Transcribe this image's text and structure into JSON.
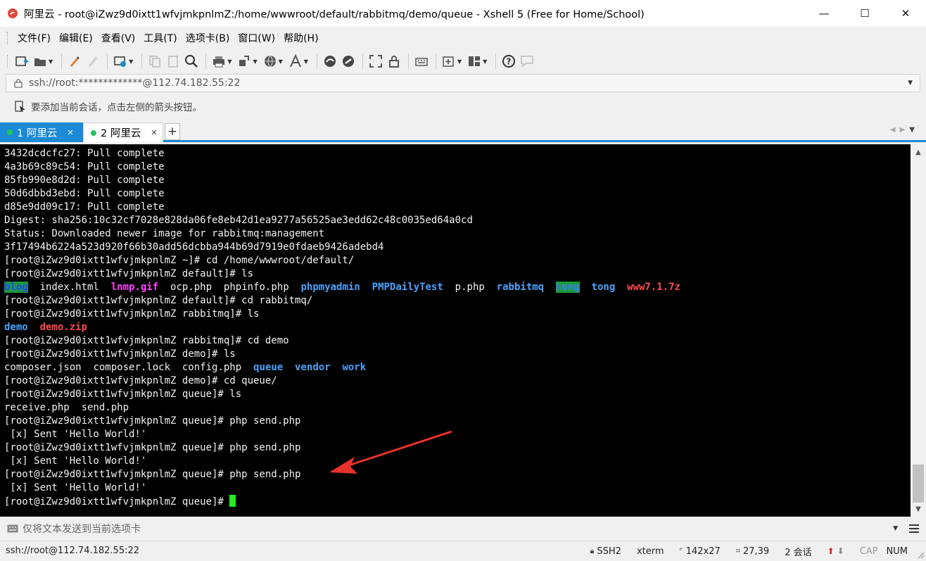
{
  "window": {
    "title": "阿里云 - root@iZwz9d0ixtt1wfvjmkpnlmZ:/home/wwwroot/default/rabbitmq/demo/queue - Xshell 5 (Free for Home/School)",
    "minimize": "—",
    "maximize": "☐",
    "close": "✕"
  },
  "menu": [
    "文件(F)",
    "编辑(E)",
    "查看(V)",
    "工具(T)",
    "选项卡(B)",
    "窗口(W)",
    "帮助(H)"
  ],
  "address": {
    "value": "ssh://root:*************@112.74.182.55:22"
  },
  "hint": "要添加当前会话，点击左侧的箭头按钮。",
  "tabs": [
    {
      "label": "1 阿里云",
      "status": "connected",
      "active": true
    },
    {
      "label": "2 阿里云",
      "status": "connected",
      "active": false
    }
  ],
  "terminal": {
    "lines": [
      "3432dcdcfc27: Pull complete",
      "4a3b69c89c54: Pull complete",
      "85fb990e8d2d: Pull complete",
      "50d6dbbd3ebd: Pull complete",
      "d85e9dd09c17: Pull complete",
      "Digest: sha256:10c32cf7028e828da06fe8eb42d1ea9277a56525ae3edd62c48c0035ed64a0cd",
      "Status: Downloaded newer image for rabbitmq:management",
      "3f17494b6224a523d920f66b30add56dcbba944b69d7919e0fdaeb9426adebd4",
      "[root@iZwz9d0ixtt1wfvjmkpnlmZ ~]# cd /home/wwwroot/default/",
      "[root@iZwz9d0ixtt1wfvjmkpnlmZ default]# ls"
    ],
    "ls_default": [
      {
        "name": "blog",
        "kind": "dir-highlight"
      },
      {
        "name": "index.html",
        "kind": "file"
      },
      {
        "name": "lnmp.gif",
        "kind": "image"
      },
      {
        "name": "ocp.php",
        "kind": "file"
      },
      {
        "name": "phpinfo.php",
        "kind": "file"
      },
      {
        "name": "phpmyadmin",
        "kind": "dir"
      },
      {
        "name": "PMPDailyTest",
        "kind": "dir"
      },
      {
        "name": "p.php",
        "kind": "file"
      },
      {
        "name": "rabbitmq",
        "kind": "dir"
      },
      {
        "name": "song",
        "kind": "dir-highlight"
      },
      {
        "name": "tong",
        "kind": "dir"
      },
      {
        "name": "www7.1.7z",
        "kind": "archive"
      }
    ],
    "lines2": [
      "[root@iZwz9d0ixtt1wfvjmkpnlmZ default]# cd rabbitmq/",
      "[root@iZwz9d0ixtt1wfvjmkpnlmZ rabbitmq]# ls"
    ],
    "ls_rabbitmq": [
      {
        "name": "demo",
        "kind": "dir"
      },
      {
        "name": "demo.zip",
        "kind": "archive"
      }
    ],
    "lines3": [
      "[root@iZwz9d0ixtt1wfvjmkpnlmZ rabbitmq]# cd demo",
      "[root@iZwz9d0ixtt1wfvjmkpnlmZ demo]# ls"
    ],
    "ls_demo": [
      {
        "name": "composer.json",
        "kind": "file"
      },
      {
        "name": "composer.lock",
        "kind": "file"
      },
      {
        "name": "config.php",
        "kind": "file"
      },
      {
        "name": "queue",
        "kind": "dir"
      },
      {
        "name": "vendor",
        "kind": "dir"
      },
      {
        "name": "work",
        "kind": "dir"
      }
    ],
    "lines4": [
      "[root@iZwz9d0ixtt1wfvjmkpnlmZ demo]# cd queue/",
      "[root@iZwz9d0ixtt1wfvjmkpnlmZ queue]# ls",
      "receive.php  send.php",
      "[root@iZwz9d0ixtt1wfvjmkpnlmZ queue]# php send.php",
      " [x] Sent 'Hello World!'",
      "[root@iZwz9d0ixtt1wfvjmkpnlmZ queue]# php send.php",
      " [x] Sent 'Hello World!'",
      "[root@iZwz9d0ixtt1wfvjmkpnlmZ queue]# php send.php",
      " [x] Sent 'Hello World!'"
    ],
    "prompt": "[root@iZwz9d0ixtt1wfvjmkpnlmZ queue]# "
  },
  "compose": {
    "placeholder": "仅将文本发送到当前选项卡"
  },
  "status": {
    "connection": "ssh://root@112.74.182.55:22",
    "protocol": "SSH2",
    "term_type": "xterm",
    "size": "142x27",
    "cursor_pos": "27,39",
    "sessions": "2 会话",
    "caps": "CAP",
    "num": "NUM"
  },
  "colors": {
    "accent": "#1c8ad6",
    "terminal_bg": "#000000",
    "terminal_fg": "#f2f2f2",
    "cursor": "#22ee22",
    "annotation_arrow": "#e8322a"
  }
}
